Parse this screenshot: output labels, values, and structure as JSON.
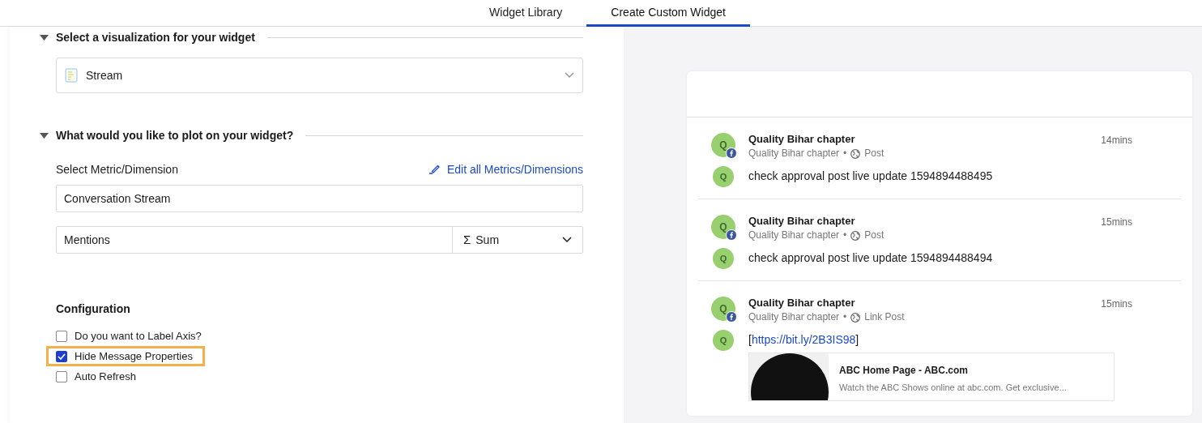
{
  "tabs": [
    {
      "label": "Widget Library",
      "selected": false
    },
    {
      "label": "Create Custom Widget",
      "selected": true
    }
  ],
  "sections": [
    {
      "title": "Select a visualization for your widget",
      "expanded": true
    },
    {
      "title": "What would you like to plot on your widget?",
      "expanded": true
    }
  ],
  "visualization": {
    "value": "Stream"
  },
  "metric": {
    "label": "Select Metric/Dimension",
    "edit_link": "Edit all Metrics/Dimensions",
    "value": "Conversation Stream",
    "dimension": "Mentions",
    "aggregation": "Sum",
    "aggregation_icon": "Σ"
  },
  "configuration": {
    "title": "Configuration",
    "options": [
      {
        "label": "Do you want to Label Axis?",
        "checked": false,
        "highlighted": false
      },
      {
        "label": "Hide Message Properties",
        "checked": true,
        "highlighted": true
      },
      {
        "label": "Auto Refresh",
        "checked": false,
        "highlighted": false
      }
    ]
  },
  "stream": [
    {
      "author": "Quality Bihar chapter",
      "avatar": "Q",
      "source": "Quality Bihar chapter",
      "separator": "•",
      "post_type": "Post",
      "time": "14mins",
      "message_avatar": "Q",
      "kind": "text",
      "text": "check approval post live update 1594894488495"
    },
    {
      "author": "Quality Bihar chapter",
      "avatar": "Q",
      "source": "Quality Bihar chapter",
      "separator": "•",
      "post_type": "Post",
      "time": "15mins",
      "message_avatar": "Q",
      "kind": "text",
      "text": "check approval post live update 1594894488494"
    },
    {
      "author": "Quality Bihar chapter",
      "avatar": "Q",
      "source": "Quality Bihar chapter",
      "separator": "•",
      "post_type": "Link Post",
      "time": "15mins",
      "message_avatar": "Q",
      "kind": "link",
      "open": "[",
      "link": "https://bit.ly/2B3IS98",
      "close": "]",
      "preview": {
        "title": "ABC Home Page - ABC.com",
        "description": "Watch the ABC Shows online at abc.com. Get exclusive..."
      }
    }
  ]
}
